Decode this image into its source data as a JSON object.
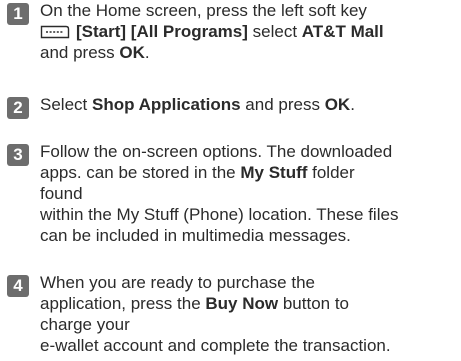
{
  "steps": [
    {
      "number": "1",
      "lines": [
        [
          "On the Home screen, press the left soft key"
        ],
        [
          "[Start] [All Programs]",
          " select ",
          "AT&T Mall"
        ],
        [
          "and press ",
          "OK",
          "."
        ]
      ]
    },
    {
      "number": "2",
      "lines": [
        [
          "Select ",
          "Shop Applications",
          " and press ",
          "OK",
          "."
        ]
      ]
    },
    {
      "number": "3",
      "lines": [
        [
          "Follow the on-screen options. The downloaded"
        ],
        [
          "apps. can be stored in the ",
          "My Stuff",
          " folder"
        ],
        [
          "found"
        ],
        [
          "within the My Stuff (Phone) location. These files"
        ],
        [
          "can be included in multimedia messages."
        ]
      ]
    },
    {
      "number": "4",
      "lines": [
        [
          "When you are ready to purchase the"
        ],
        [
          "application, press the ",
          "Buy Now",
          " button to"
        ],
        [
          "charge your"
        ],
        [
          "e-wallet account and complete the transaction."
        ]
      ]
    }
  ]
}
